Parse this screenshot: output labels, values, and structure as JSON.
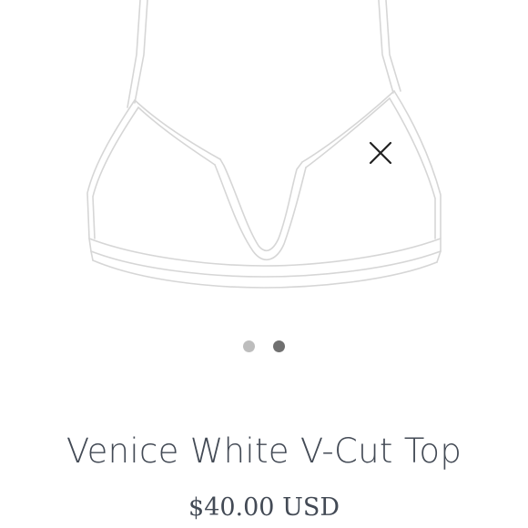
{
  "product": {
    "title": "Venice White V-Cut Top",
    "price": "$40.00 USD"
  },
  "gallery": {
    "dots": [
      {
        "state": "inactive",
        "color": "#bdbdbd"
      },
      {
        "state": "active",
        "color": "#707070"
      }
    ],
    "close_icon": "close-icon"
  },
  "colors": {
    "text": "#434a55",
    "outline": "#d6d6d6"
  }
}
